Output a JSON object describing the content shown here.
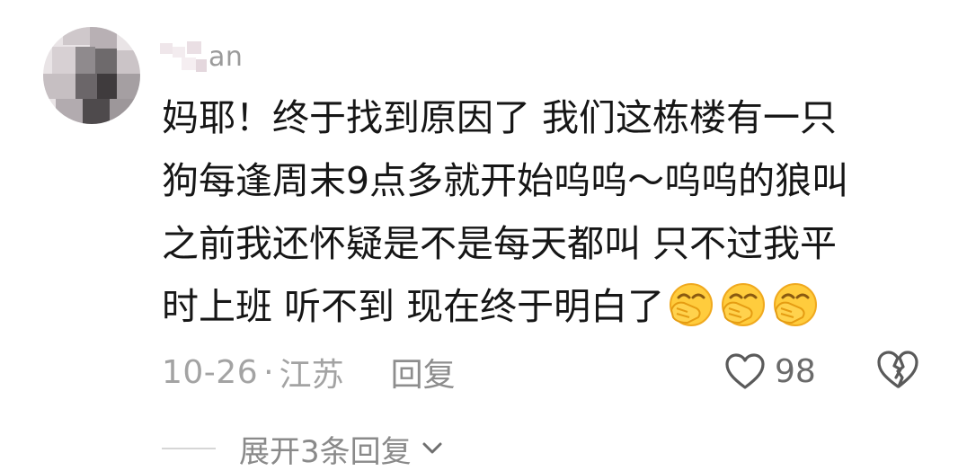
{
  "comment": {
    "username_visible": "an",
    "content_lines": [
      "妈耶！终于找到原因了 我们这栋楼有一只",
      "狗每逢周末9点多就开始呜呜～呜呜的狼叫",
      "之前我还怀疑是不是每天都叫 只不过我平",
      "时上班 听不到 现在终于明白了"
    ],
    "emojis": [
      "face-palm-emoji",
      "face-palm-emoji",
      "face-palm-emoji"
    ],
    "date": "10-26",
    "separator": "·",
    "location": "江苏",
    "reply_label": "回复",
    "like_count": "98",
    "expand_label": "展开3条回复"
  },
  "colors": {
    "text": "#161616",
    "meta": "#a3a3a3",
    "emoji": "#ffc93a"
  }
}
